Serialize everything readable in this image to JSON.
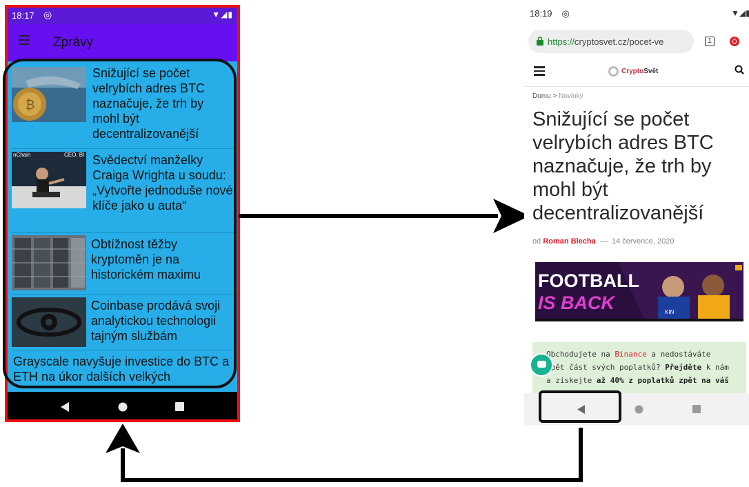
{
  "left_phone": {
    "status": {
      "time": "18:17",
      "notif_icon": "at-sign-icon",
      "signal_icons": "▼◢▮"
    },
    "appbar": {
      "menu_icon": "hamburger-menu-icon",
      "title": "Zprávy"
    },
    "news": [
      {
        "title": "Snižující se počet velrybích adres BTC naznačuje, že trh by mohl být decentralizovanější",
        "thumb": "whale-bitcoin-image"
      },
      {
        "title": "Svědectví manželky Craiga Wrighta u soudu: „Vytvořte jednoduše nové klíče jako u auta“",
        "thumb": "conference-speaker-image",
        "thumb_caption_left": "nChain",
        "thumb_caption_right": "CEO, BI"
      },
      {
        "title": "Obtížnost těžby kryptoměn je na historickém maximu",
        "thumb": "mining-rigs-image"
      },
      {
        "title": "Coinbase prodává svoji analytickou technologii tajným službám",
        "thumb": "digital-eye-image"
      },
      {
        "title": "Grayscale navyšuje investice do BTC a ETH na úkor dalších velkých",
        "thumb": ""
      }
    ],
    "nav": {
      "back": "back-triangle-icon",
      "home": "home-circle-icon",
      "recents": "recents-square-icon"
    }
  },
  "right_phone": {
    "status": {
      "time": "18:19",
      "notif_icon": "at-sign-icon",
      "signal_icons": "▼◢▮"
    },
    "browser": {
      "url_scheme": "https://",
      "url_rest": "cryptosvet.cz/pocet-ve",
      "tabs_count": "1"
    },
    "site": {
      "logo_crypto": "Crypto",
      "logo_svet": "Svět",
      "breadcrumb_home": "Domu",
      "breadcrumb_sep": ">",
      "breadcrumb_current": "Novinky"
    },
    "article": {
      "title": "Snižující se počet velrybích adres BTC naznačuje, že trh by mohl být decentralizovanější",
      "byline_prefix": "od",
      "author": "Roman Blecha",
      "dash": "—",
      "date": "14 července, 2020"
    },
    "ad": {
      "line1": "FOOTBALL",
      "line2": "IS BACK",
      "shirt_text": "KIN"
    },
    "promo": {
      "p1": "Obchodujete na ",
      "binance": "Binance",
      "p2": " a nedostáváte",
      "p3": "zpět část svých poplatků? ",
      "prejdete": "Přejděte",
      "p4": " k nám",
      "p5": "a získejte ",
      "bold": "až 40% z poplatků zpět na váš"
    }
  },
  "colors": {
    "left_frame": "#ee1111",
    "left_bg": "#27aee8",
    "left_appbar": "#6610f2",
    "left_status": "#5a1ad6",
    "arrow": "#000000",
    "accent_red": "#e0202a",
    "promo_bg": "#dff0d8",
    "fab": "#19b394"
  }
}
